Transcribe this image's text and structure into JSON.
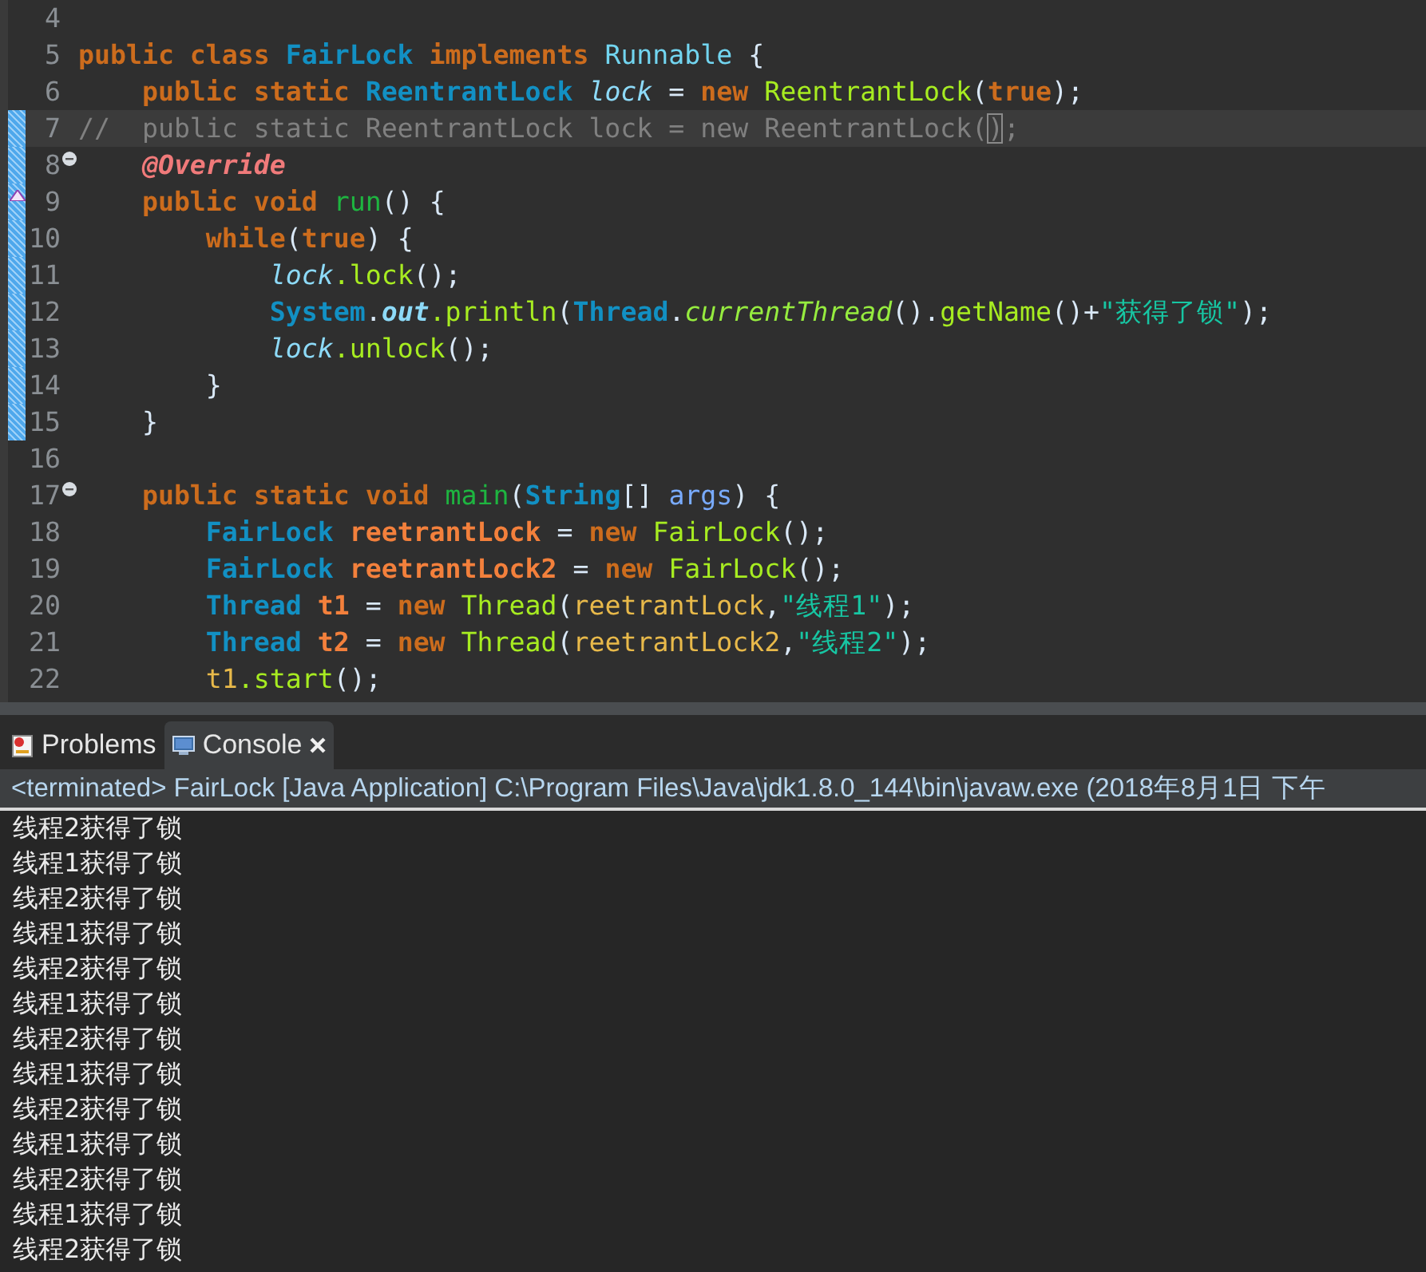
{
  "editor": {
    "lines": [
      {
        "number": "4",
        "changed": false,
        "current": false,
        "folding": false,
        "override": false
      },
      {
        "number": "5",
        "changed": false,
        "current": false,
        "folding": false,
        "override": false,
        "tokens": [
          {
            "text": "public class ",
            "kind": "kw"
          },
          {
            "text": "FairLock",
            "kind": "type"
          },
          {
            "text": " implements ",
            "kind": "kw"
          },
          {
            "text": "Runnable",
            "kind": "iface"
          },
          {
            "text": " {",
            "kind": "plain"
          }
        ]
      },
      {
        "number": "6",
        "changed": false,
        "current": false,
        "folding": false,
        "override": false,
        "tokens": [
          {
            "text": "    public static ",
            "kind": "kw"
          },
          {
            "text": "ReentrantLock ",
            "kind": "type"
          },
          {
            "text": "lock",
            "kind": "field"
          },
          {
            "text": " = ",
            "kind": "plain"
          },
          {
            "text": "new ",
            "kind": "kw"
          },
          {
            "text": "ReentrantLock",
            "kind": "method"
          },
          {
            "text": "(",
            "kind": "plain"
          },
          {
            "text": "true",
            "kind": "kw"
          },
          {
            "text": ");",
            "kind": "plain"
          }
        ]
      },
      {
        "number": "7",
        "changed": true,
        "current": true,
        "folding": false,
        "override": false,
        "tokens": [
          {
            "text": "//  public static ReentrantLock lock = new ReentrantLock(",
            "kind": "comment"
          },
          {
            "text": ")",
            "kind": "match"
          },
          {
            "text": ";",
            "kind": "comment"
          }
        ]
      },
      {
        "number": "8",
        "changed": true,
        "current": false,
        "folding": true,
        "override": false,
        "tokens": [
          {
            "text": "    @Override",
            "kind": "anno"
          }
        ]
      },
      {
        "number": "9",
        "changed": true,
        "current": false,
        "folding": false,
        "override": true,
        "tokens": [
          {
            "text": "    public void ",
            "kind": "kw"
          },
          {
            "text": "run",
            "kind": "decl"
          },
          {
            "text": "() {",
            "kind": "plain"
          }
        ]
      },
      {
        "number": "10",
        "changed": true,
        "current": false,
        "folding": false,
        "override": false,
        "tokens": [
          {
            "text": "        while",
            "kind": "kw"
          },
          {
            "text": "(",
            "kind": "plain"
          },
          {
            "text": "true",
            "kind": "kw"
          },
          {
            "text": ") {",
            "kind": "plain"
          }
        ]
      },
      {
        "number": "11",
        "changed": true,
        "current": false,
        "folding": false,
        "override": false,
        "tokens": [
          {
            "text": "            lock",
            "kind": "field"
          },
          {
            "text": ".lock",
            "kind": "method"
          },
          {
            "text": "();",
            "kind": "plain"
          }
        ]
      },
      {
        "number": "12",
        "changed": true,
        "current": false,
        "folding": false,
        "override": false,
        "tokens": [
          {
            "text": "            System",
            "kind": "type"
          },
          {
            "text": ".",
            "kind": "plain"
          },
          {
            "text": "out",
            "kind": "sfield"
          },
          {
            "text": ".println",
            "kind": "method"
          },
          {
            "text": "(",
            "kind": "plain"
          },
          {
            "text": "Thread",
            "kind": "type"
          },
          {
            "text": ".",
            "kind": "plain"
          },
          {
            "text": "currentThread",
            "kind": "smethod"
          },
          {
            "text": "().",
            "kind": "plain"
          },
          {
            "text": "getName",
            "kind": "method"
          },
          {
            "text": "()+",
            "kind": "plain"
          },
          {
            "text": "\"获得了锁\"",
            "kind": "string"
          },
          {
            "text": ");",
            "kind": "plain"
          }
        ]
      },
      {
        "number": "13",
        "changed": true,
        "current": false,
        "folding": false,
        "override": false,
        "tokens": [
          {
            "text": "            lock",
            "kind": "field"
          },
          {
            "text": ".unlock",
            "kind": "method"
          },
          {
            "text": "();",
            "kind": "plain"
          }
        ]
      },
      {
        "number": "14",
        "changed": true,
        "current": false,
        "folding": false,
        "override": false,
        "tokens": [
          {
            "text": "        }",
            "kind": "plain"
          }
        ]
      },
      {
        "number": "15",
        "changed": true,
        "current": false,
        "folding": false,
        "override": false,
        "tokens": [
          {
            "text": "    }",
            "kind": "plain"
          }
        ]
      },
      {
        "number": "16",
        "changed": false,
        "current": false,
        "folding": false,
        "override": false
      },
      {
        "number": "17",
        "changed": false,
        "current": false,
        "folding": true,
        "override": false,
        "tokens": [
          {
            "text": "    public static void ",
            "kind": "kw"
          },
          {
            "text": "main",
            "kind": "decl"
          },
          {
            "text": "(",
            "kind": "plain"
          },
          {
            "text": "String",
            "kind": "type"
          },
          {
            "text": "[] ",
            "kind": "plain"
          },
          {
            "text": "args",
            "kind": "param"
          },
          {
            "text": ") {",
            "kind": "plain"
          }
        ]
      },
      {
        "number": "18",
        "changed": false,
        "current": false,
        "folding": false,
        "override": false,
        "tokens": [
          {
            "text": "        FairLock ",
            "kind": "type"
          },
          {
            "text": "reetrantLock",
            "kind": "local"
          },
          {
            "text": " = ",
            "kind": "plain"
          },
          {
            "text": "new ",
            "kind": "kw"
          },
          {
            "text": "FairLock",
            "kind": "method"
          },
          {
            "text": "();",
            "kind": "plain"
          }
        ]
      },
      {
        "number": "19",
        "changed": false,
        "current": false,
        "folding": false,
        "override": false,
        "tokens": [
          {
            "text": "        FairLock ",
            "kind": "type"
          },
          {
            "text": "reetrantLock2",
            "kind": "local"
          },
          {
            "text": " = ",
            "kind": "plain"
          },
          {
            "text": "new ",
            "kind": "kw"
          },
          {
            "text": "FairLock",
            "kind": "method"
          },
          {
            "text": "();",
            "kind": "plain"
          }
        ]
      },
      {
        "number": "20",
        "changed": false,
        "current": false,
        "folding": false,
        "override": false,
        "tokens": [
          {
            "text": "        Thread ",
            "kind": "type"
          },
          {
            "text": "t1",
            "kind": "local"
          },
          {
            "text": " = ",
            "kind": "plain"
          },
          {
            "text": "new ",
            "kind": "kw"
          },
          {
            "text": "Thread",
            "kind": "method"
          },
          {
            "text": "(",
            "kind": "plain"
          },
          {
            "text": "reetrantLock",
            "kind": "localref"
          },
          {
            "text": ",",
            "kind": "plain"
          },
          {
            "text": "\"线程1\"",
            "kind": "string"
          },
          {
            "text": ");",
            "kind": "plain"
          }
        ]
      },
      {
        "number": "21",
        "changed": false,
        "current": false,
        "folding": false,
        "override": false,
        "tokens": [
          {
            "text": "        Thread ",
            "kind": "type"
          },
          {
            "text": "t2",
            "kind": "local"
          },
          {
            "text": " = ",
            "kind": "plain"
          },
          {
            "text": "new ",
            "kind": "kw"
          },
          {
            "text": "Thread",
            "kind": "method"
          },
          {
            "text": "(",
            "kind": "plain"
          },
          {
            "text": "reetrantLock2",
            "kind": "localref"
          },
          {
            "text": ",",
            "kind": "plain"
          },
          {
            "text": "\"线程2\"",
            "kind": "string"
          },
          {
            "text": ");",
            "kind": "plain"
          }
        ]
      },
      {
        "number": "22",
        "changed": false,
        "current": false,
        "folding": false,
        "override": false,
        "tokens": [
          {
            "text": "        t1",
            "kind": "localref"
          },
          {
            "text": ".start",
            "kind": "method"
          },
          {
            "text": "();",
            "kind": "plain"
          }
        ]
      }
    ]
  },
  "tabs": [
    {
      "label": "Problems",
      "kind": "problems",
      "selected": false,
      "closable": false
    },
    {
      "label": "Console",
      "kind": "console",
      "selected": true,
      "closable": true
    }
  ],
  "console": {
    "header": "<terminated> FairLock [Java Application] C:\\Program Files\\Java\\jdk1.8.0_144\\bin\\javaw.exe (2018年8月1日 下午",
    "output": [
      "线程2获得了锁",
      "线程1获得了锁",
      "线程2获得了锁",
      "线程1获得了锁",
      "线程2获得了锁",
      "线程1获得了锁",
      "线程2获得了锁",
      "线程1获得了锁",
      "线程2获得了锁",
      "线程1获得了锁",
      "线程2获得了锁",
      "线程1获得了锁",
      "线程2获得了锁"
    ]
  }
}
